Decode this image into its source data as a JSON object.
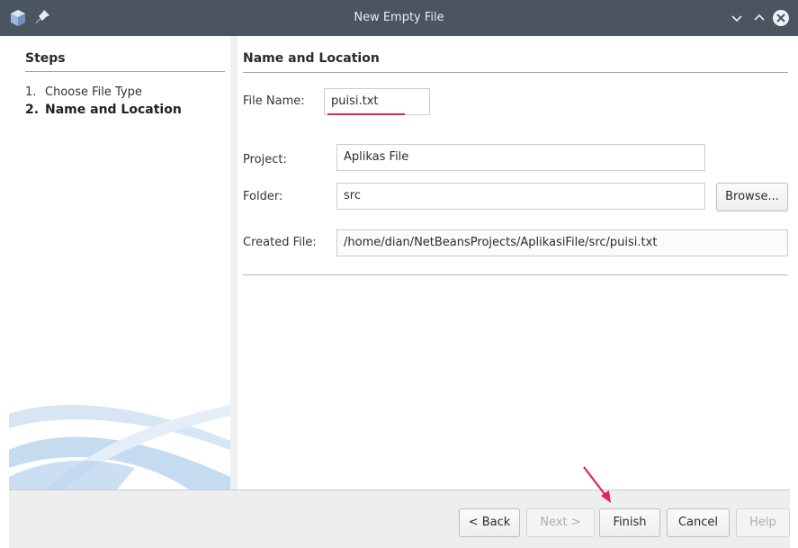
{
  "window": {
    "title": "New Empty File"
  },
  "steps": {
    "heading": "Steps",
    "items": [
      {
        "number": "1.",
        "label": "Choose File Type",
        "active": false
      },
      {
        "number": "2.",
        "label": "Name and Location",
        "active": true
      }
    ]
  },
  "content": {
    "heading": "Name and Location",
    "file_name": {
      "label": "File Name:",
      "value": "puisi.txt"
    },
    "project": {
      "label": "Project:",
      "value": "Aplikas File"
    },
    "folder": {
      "label": "Folder:",
      "value": "src"
    },
    "browse_label": "Browse...",
    "created_file": {
      "label": "Created File:",
      "value": "/home/dian/NetBeansProjects/AplikasiFile/src/puisi.txt"
    }
  },
  "buttons": {
    "back": "< Back",
    "next": "Next >",
    "finish": "Finish",
    "cancel": "Cancel",
    "help": "Help"
  },
  "colors": {
    "titlebar": "#4a5560",
    "annotation": "#e0245e"
  }
}
